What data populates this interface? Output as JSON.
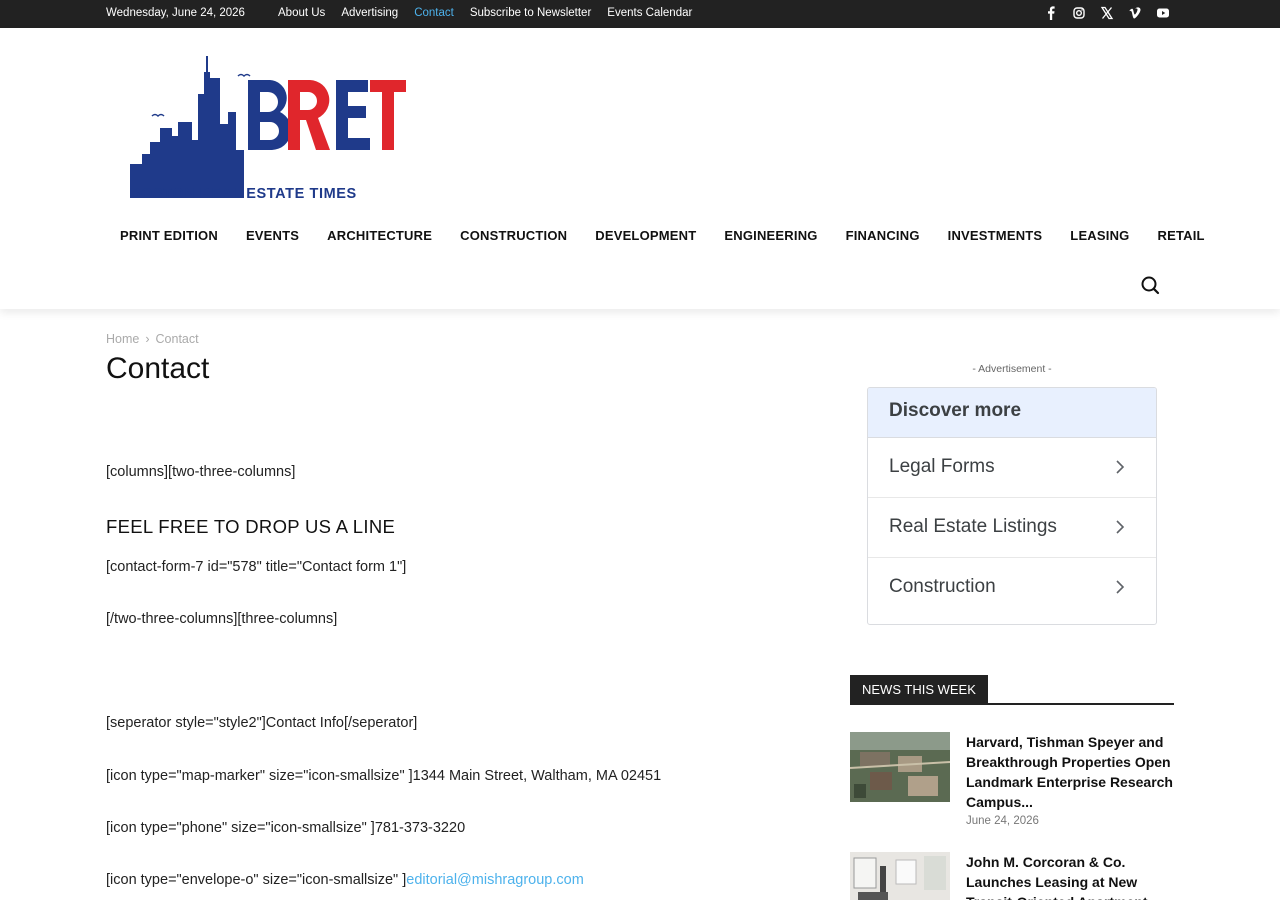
{
  "topbar": {
    "date": "Wednesday, June 24, 2026",
    "links": [
      "About Us",
      "Advertising",
      "Contact",
      "Subscribe to Newsletter",
      "Events Calendar"
    ],
    "active_link": "Contact",
    "socials": [
      "facebook-icon",
      "instagram-icon",
      "x-icon",
      "vimeo-icon",
      "youtube-icon"
    ]
  },
  "logo": {
    "letters": "BRET",
    "tagline": "BOSTON REAL ESTATE TIMES",
    "colors": {
      "navy": "#1f3a8a",
      "red": "#e0262c"
    }
  },
  "nav": [
    "PRINT EDITION",
    "EVENTS",
    "ARCHITECTURE",
    "CONSTRUCTION",
    "DEVELOPMENT",
    "ENGINEERING",
    "FINANCING",
    "INVESTMENTS",
    "LEASING",
    "RETAIL"
  ],
  "breadcrumb": {
    "home": "Home",
    "separator": "›",
    "current": "Contact"
  },
  "page_title": "Contact",
  "content": {
    "line1": "[columns][two-three-columns]",
    "heading": "FEEL FREE TO DROP US A LINE",
    "line2": "[contact-form-7 id=\"578\" title=\"Contact form 1\"]",
    "line3": "[/two-three-columns][three-columns]",
    "line4": "[seperator style=\"style2\"]Contact Info[/seperator]",
    "line5": "[icon type=\"map-marker\" size=\"icon-smallsize\" ]1344 Main Street, Waltham, MA 02451",
    "line6": "[icon type=\"phone\" size=\"icon-smallsize\" ]781-373-3220",
    "line7_prefix": "[icon type=\"envelope-o\" size=\"icon-smallsize\" ]",
    "line7_link": "editorial@mishragroup.com"
  },
  "sidebar": {
    "ad_label": "- Advertisement -",
    "discover": {
      "title": "Discover more",
      "items": [
        "Legal Forms",
        "Real Estate Listings",
        "Construction"
      ]
    },
    "news_title": "NEWS THIS WEEK",
    "news": [
      {
        "title": "Harvard, Tishman Speyer and Breakthrough Properties Open Landmark Enterprise Research Campus...",
        "date": "June 24, 2026"
      },
      {
        "title": "John M. Corcoran & Co. Launches Leasing at New Transit-Oriented Apartment...",
        "date": ""
      }
    ]
  },
  "colors": {
    "accent": "#4db2ec",
    "topbar_bg": "#222222"
  }
}
